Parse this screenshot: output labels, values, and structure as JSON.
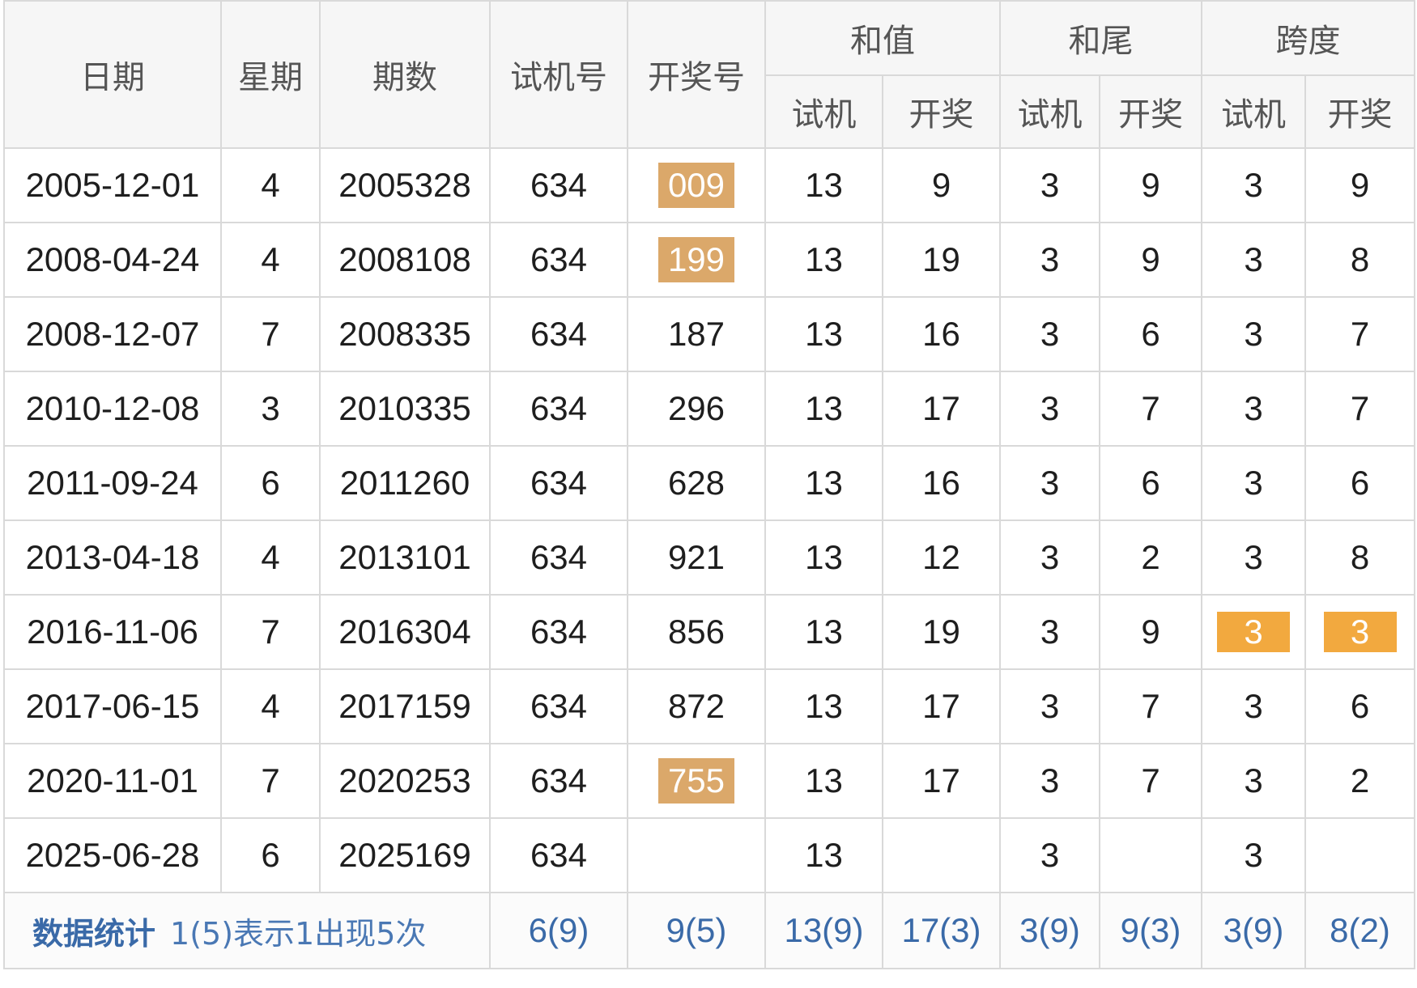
{
  "header": {
    "date": "日期",
    "weekday": "星期",
    "issue": "期数",
    "trial_number": "试机号",
    "draw_number": "开奖号",
    "sum": "和值",
    "sum_tail": "和尾",
    "span": "跨度",
    "sub_trial": "试机",
    "sub_draw": "开奖"
  },
  "rows": [
    {
      "date": "2005-12-01",
      "weekday": "4",
      "issue": "2005328",
      "trial": "634",
      "draw": "009",
      "draw_highlighted": true,
      "sum_trial": "13",
      "sum_draw": "9",
      "tail_trial": "3",
      "tail_draw": "9",
      "span_trial": "3",
      "span_draw": "9"
    },
    {
      "date": "2008-04-24",
      "weekday": "4",
      "issue": "2008108",
      "trial": "634",
      "draw": "199",
      "draw_highlighted": true,
      "sum_trial": "13",
      "sum_draw": "19",
      "tail_trial": "3",
      "tail_draw": "9",
      "span_trial": "3",
      "span_draw": "8"
    },
    {
      "date": "2008-12-07",
      "weekday": "7",
      "issue": "2008335",
      "trial": "634",
      "draw": "187",
      "draw_highlighted": false,
      "sum_trial": "13",
      "sum_draw": "16",
      "tail_trial": "3",
      "tail_draw": "6",
      "span_trial": "3",
      "span_draw": "7"
    },
    {
      "date": "2010-12-08",
      "weekday": "3",
      "issue": "2010335",
      "trial": "634",
      "draw": "296",
      "draw_highlighted": false,
      "sum_trial": "13",
      "sum_draw": "17",
      "tail_trial": "3",
      "tail_draw": "7",
      "span_trial": "3",
      "span_draw": "7"
    },
    {
      "date": "2011-09-24",
      "weekday": "6",
      "issue": "2011260",
      "trial": "634",
      "draw": "628",
      "draw_highlighted": false,
      "sum_trial": "13",
      "sum_draw": "16",
      "tail_trial": "3",
      "tail_draw": "6",
      "span_trial": "3",
      "span_draw": "6"
    },
    {
      "date": "2013-04-18",
      "weekday": "4",
      "issue": "2013101",
      "trial": "634",
      "draw": "921",
      "draw_highlighted": false,
      "sum_trial": "13",
      "sum_draw": "12",
      "tail_trial": "3",
      "tail_draw": "2",
      "span_trial": "3",
      "span_draw": "8"
    },
    {
      "date": "2016-11-06",
      "weekday": "7",
      "issue": "2016304",
      "trial": "634",
      "draw": "856",
      "draw_highlighted": false,
      "sum_trial": "13",
      "sum_draw": "19",
      "tail_trial": "3",
      "tail_draw": "9",
      "span_trial": "3",
      "span_draw": "3",
      "span_highlighted": true
    },
    {
      "date": "2017-06-15",
      "weekday": "4",
      "issue": "2017159",
      "trial": "634",
      "draw": "872",
      "draw_highlighted": false,
      "sum_trial": "13",
      "sum_draw": "17",
      "tail_trial": "3",
      "tail_draw": "7",
      "span_trial": "3",
      "span_draw": "6"
    },
    {
      "date": "2020-11-01",
      "weekday": "7",
      "issue": "2020253",
      "trial": "634",
      "draw": "755",
      "draw_highlighted": true,
      "sum_trial": "13",
      "sum_draw": "17",
      "tail_trial": "3",
      "tail_draw": "7",
      "span_trial": "3",
      "span_draw": "2"
    },
    {
      "date": "2025-06-28",
      "weekday": "6",
      "issue": "2025169",
      "trial": "634",
      "draw": "",
      "draw_highlighted": false,
      "sum_trial": "13",
      "sum_draw": "",
      "tail_trial": "3",
      "tail_draw": "",
      "span_trial": "3",
      "span_draw": ""
    }
  ],
  "stats": {
    "label": "数据统计",
    "note": "1(5)表示1出现5次",
    "trial": "6(9)",
    "draw": "9(5)",
    "sum_trial": "13(9)",
    "sum_draw": "17(3)",
    "tail_trial": "3(9)",
    "tail_draw": "9(3)",
    "span_trial": "3(9)",
    "span_draw": "8(2)"
  },
  "colors": {
    "draw_red": "#b5282a",
    "highlight_tan": "#dba86a",
    "highlight_orange": "#f2a93f",
    "stats_blue": "#3a6aa8",
    "header_bg": "#f6f6f6",
    "border": "#d9d9d9"
  }
}
